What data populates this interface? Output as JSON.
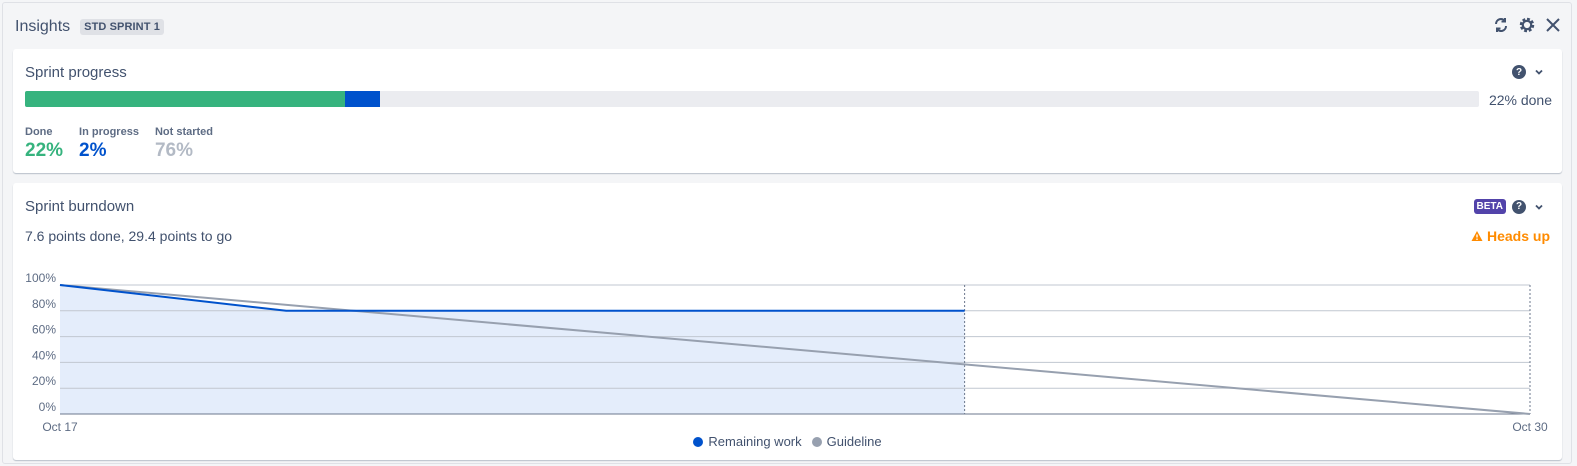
{
  "header": {
    "title": "Insights",
    "sprint_badge": "STD SPRINT 1",
    "icons": [
      "refresh-icon",
      "gear-icon",
      "close-icon"
    ]
  },
  "sprint_progress": {
    "title": "Sprint progress",
    "done_text": "22% done",
    "done_fraction": 0.22,
    "in_progress_fraction": 0.024,
    "stats": {
      "done_label": "Done",
      "done_value": "22%",
      "in_progress_label": "In progress",
      "in_progress_value": "2%",
      "not_started_label": "Not started",
      "not_started_value": "76%"
    },
    "colors": {
      "done": "#36b37e",
      "in_progress": "#0052cc",
      "not_started": "#b3bac5"
    }
  },
  "sprint_burndown": {
    "title": "Sprint burndown",
    "badge": "BETA",
    "summary": "7.6 points done, 29.4 points to go",
    "heads_up": "Heads up",
    "legend": {
      "remaining": "Remaining work",
      "guideline": "Guideline"
    },
    "colors": {
      "remaining": "#0052cc",
      "guideline": "#97a0af",
      "area": "#e4edfb"
    }
  },
  "chart_data": {
    "type": "line",
    "x_start_label": "Oct 17",
    "x_end_label": "Oct 30",
    "ylim": [
      0,
      100
    ],
    "yticks": [
      "0%",
      "20%",
      "40%",
      "60%",
      "80%",
      "100%"
    ],
    "days": 13,
    "today_day": 8,
    "series": [
      {
        "name": "Remaining work",
        "points": [
          [
            0,
            100
          ],
          [
            2,
            80
          ],
          [
            8,
            80
          ]
        ]
      },
      {
        "name": "Guideline",
        "points": [
          [
            0,
            100
          ],
          [
            13,
            0
          ]
        ]
      }
    ]
  }
}
